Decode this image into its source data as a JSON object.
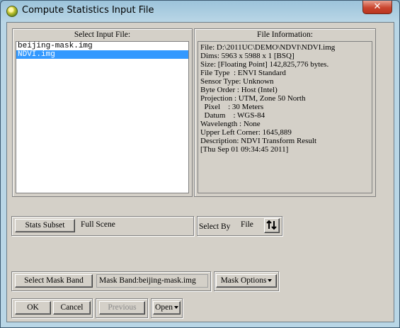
{
  "window": {
    "title": "Compute Statistics Input File",
    "close_glyph": "✕"
  },
  "select_input": {
    "heading": "Select Input File:",
    "files": [
      "beijing-mask.img",
      "NDVI.img"
    ],
    "selected_index": 1
  },
  "file_info": {
    "heading": "File Information:",
    "lines": [
      "File: D:\\2011UC\\DEMO\\NDVI\\NDVI.img",
      "Dims: 5963 x 5988 x 1 [BSQ]",
      "Size: [Floating Point] 142,825,776 bytes.",
      "File Type  : ENVI Standard",
      "Sensor Type: Unknown",
      "Byte Order : Host (Intel)",
      "Projection : UTM, Zone 50 North",
      "  Pixel    : 30 Meters",
      "  Datum    : WGS-84",
      "Wavelength : None",
      "Upper Left Corner: 1645,889",
      "Description: NDVI Transform Result",
      "[Thu Sep 01 09:34:45 2011]"
    ]
  },
  "subset": {
    "button": "Stats Subset",
    "value": "Full Scene"
  },
  "select_by": {
    "label": "Select By",
    "value": "File",
    "sort_icon": "sort-arrows-icon"
  },
  "mask": {
    "button": "Select Mask Band",
    "value": "Mask Band:beijing-mask.img",
    "options_button": "Mask Options"
  },
  "footer": {
    "ok": "OK",
    "cancel": "Cancel",
    "previous": "Previous",
    "open": "Open"
  }
}
